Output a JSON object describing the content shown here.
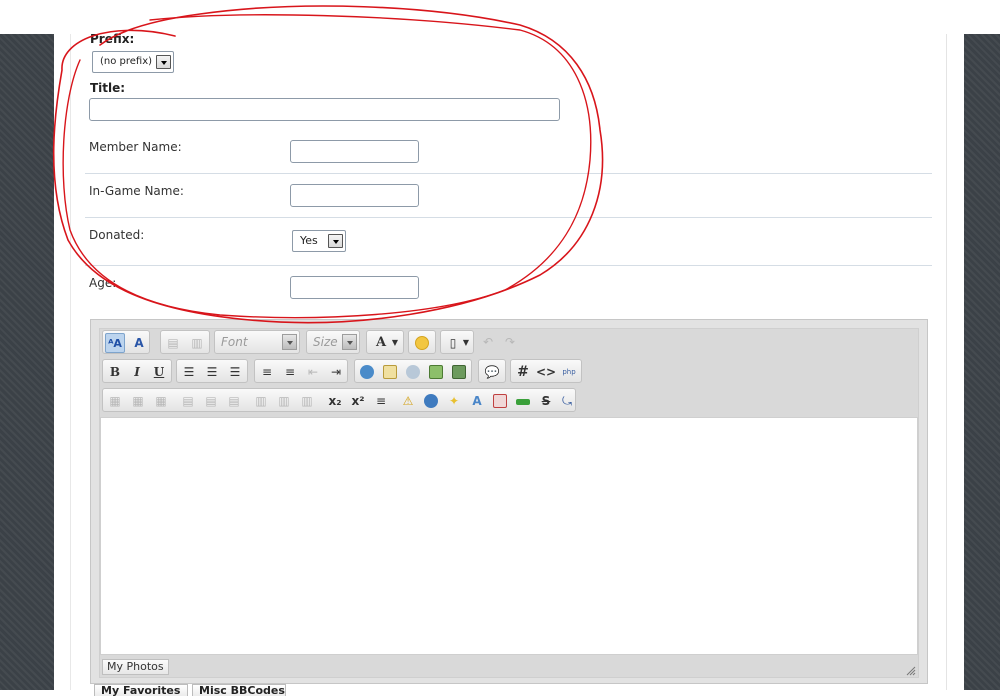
{
  "form": {
    "prefix_label": "Prefix:",
    "prefix_value": "(no prefix)",
    "title_label": "Title:",
    "title_value": "",
    "member_name_label": "Member Name:",
    "member_name_value": "",
    "ingame_name_label": "In-Game Name:",
    "ingame_name_value": "",
    "donated_label": "Donated:",
    "donated_value": "Yes",
    "age_label": "Age:",
    "age_value": ""
  },
  "editor": {
    "font_placeholder": "Font",
    "size_placeholder": "Size",
    "bold": "B",
    "italic": "I",
    "underline": "U",
    "hash": "#",
    "code": "<>",
    "php": "php",
    "subscript": "x₂",
    "superscript": "x²",
    "strike": "S",
    "font_color": "A",
    "body_text": "",
    "photos_tab": "My Photos"
  },
  "bottom_tabs": [
    "My Favorites",
    "Misc BBCodes"
  ],
  "colors": {
    "annotation": "#d8151b",
    "side_bg": "#3b4147"
  }
}
